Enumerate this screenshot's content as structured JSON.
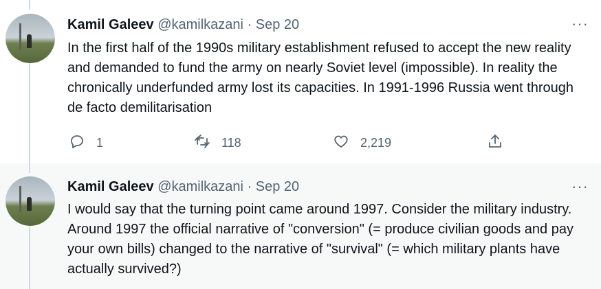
{
  "tweets": [
    {
      "author_name": "Kamil Galeev",
      "handle": "@kamilkazani",
      "separator": "·",
      "date": "Sep 20",
      "more_label": "···",
      "text": "In the first half of the 1990s military establishment  refused to accept the new reality and demanded to fund the army on nearly Soviet level (impossible). In reality the chronically underfunded army lost its capacities. In 1991-1996 Russia went through de facto demilitarisation",
      "replies": "1",
      "retweets": "118",
      "likes": "2,219"
    },
    {
      "author_name": "Kamil Galeev",
      "handle": "@kamilkazani",
      "separator": "·",
      "date": "Sep 20",
      "more_label": "···",
      "text": "I would say that the turning point came around 1997. Consider the military industry. Around 1997 the official narrative of \"conversion\" (= produce civilian goods and pay your own bills) changed to the narrative of \"survival\" (= which military plants have actually survived?)"
    }
  ],
  "icons": {
    "reply": "reply-icon",
    "retweet": "retweet-icon",
    "like": "heart-icon",
    "share": "share-icon"
  },
  "colors": {
    "text_primary": "#0f1419",
    "text_secondary": "#536471",
    "thread_line": "#cfd9de",
    "second_tweet_bg": "#f7f9f9"
  }
}
